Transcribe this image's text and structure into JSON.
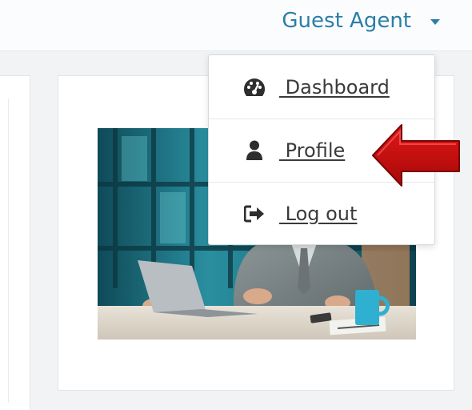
{
  "header": {
    "user_name": "Guest Agent",
    "caret_icon": "caret-down-icon",
    "accent_color": "#2a7ea7"
  },
  "user_menu": {
    "items": [
      {
        "label": " Dashboard",
        "icon": "dashboard-gauge-icon"
      },
      {
        "label": " Profile",
        "icon": "user-icon"
      },
      {
        "label": " Log out",
        "icon": "sign-out-icon"
      }
    ]
  },
  "annotation": {
    "arrow_color": "#c40c0c",
    "points_to": "Profile"
  }
}
